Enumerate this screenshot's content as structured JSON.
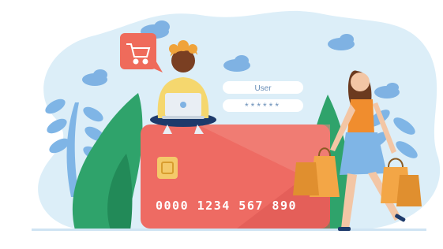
{
  "login": {
    "user_label": "User",
    "password_mask": "******"
  },
  "card": {
    "number": "0000 1234  567  890"
  },
  "icons": {
    "cart": "shopping-cart-icon",
    "chip": "card-chip-icon",
    "laptop_logo": "laptop-logo-icon"
  },
  "colors": {
    "sky_blob": "#dceef8",
    "card_red": "#ee6b63",
    "card_red_dark": "#d9534f",
    "cart_bubble": "#ef6b5b",
    "chip_gold": "#f4c96a",
    "leaf_green": "#2fa36b",
    "leaf_blue": "#7fb5e6",
    "shopping_bag": "#f3a646",
    "cloud": "#7fb2e3"
  }
}
